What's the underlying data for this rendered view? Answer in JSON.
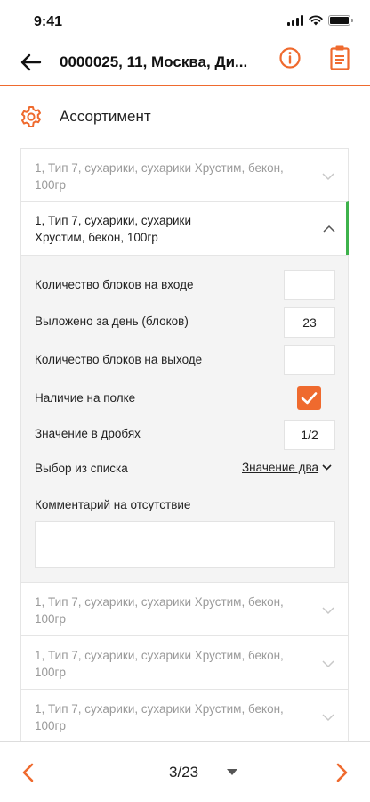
{
  "status_bar": {
    "time": "9:41"
  },
  "header": {
    "title": "0000025, 11, Москва, Ди..."
  },
  "section": {
    "title": "Ассортимент"
  },
  "items": [
    {
      "label": "1, Тип 7, сухарики, сухарики Хрустим, бекон, 100гр"
    },
    {
      "label": "1, Тип 7, сухарики, сухарики Хрустим, бекон, 100гр"
    },
    {
      "label": "1, Тип 7, сухарики, сухарики Хрустим, бекон, 100гр"
    },
    {
      "label": "1, Тип 7, сухарики, сухарики Хрустим, бекон, 100гр"
    },
    {
      "label": "1, Тип 7, сухарики, сухарики Хрустим, бекон, 100гр"
    }
  ],
  "details": {
    "blocks_in_label": "Количество блоков на входе",
    "blocks_in_value": "",
    "laid_out_label": "Выложено за день (блоков)",
    "laid_out_value": "23",
    "blocks_out_label": "Количество блоков на выходе",
    "blocks_out_value": "",
    "on_shelf_label": "Наличие на полке",
    "on_shelf_checked": true,
    "fraction_label": "Значение в дробях",
    "fraction_value": "1/2",
    "list_label": "Выбор из списка",
    "list_value": "Значение два",
    "comment_label": "Комментарий на отсутствие",
    "comment_value": ""
  },
  "pager": {
    "text": "3/23"
  },
  "colors": {
    "accent": "#ef6a2e",
    "active_marker": "#3db24b"
  },
  "icons": {
    "back": "arrow-left-icon",
    "info": "info-circle-icon",
    "clipboard": "clipboard-icon",
    "section": "gear-icon",
    "prev": "chevron-left-icon",
    "next": "chevron-right-icon"
  }
}
